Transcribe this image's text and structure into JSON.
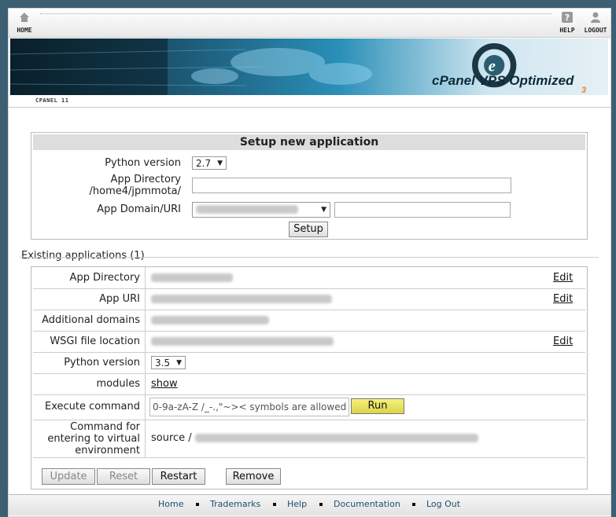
{
  "topbar": {
    "home_label": "HOME",
    "help_label": "HELP",
    "logout_label": "LOGOUT"
  },
  "banner": {
    "brand_text": "cPanel VPS Optimized",
    "brand_sub": "3"
  },
  "crumb": "CPANEL 11",
  "setup": {
    "title": "Setup new application",
    "python_version_label": "Python version",
    "python_version_value": "2.7",
    "app_dir_label_1": "App Directory",
    "app_dir_label_2": "/home4/jpmmota/",
    "app_dir_value": "",
    "app_domain_label": "App Domain/URI",
    "app_uri_value": "",
    "setup_button": "Setup"
  },
  "existing": {
    "title": "Existing applications (1)",
    "rows": {
      "app_directory": "App Directory",
      "app_uri": "App URI",
      "additional_domains": "Additional domains",
      "wsgi": "WSGI file location",
      "python_version": "Python version",
      "modules": "modules",
      "execute": "Execute command",
      "cmd_venv_1": "Command for",
      "cmd_venv_2": "entering to virtual",
      "cmd_venv_3": "environment"
    },
    "edit_label": "Edit",
    "python_version_value": "3.5",
    "modules_link": "show",
    "execute_placeholder": "0-9a-zA-Z /_-.,\"~>< symbols are allowed",
    "run_button": "Run",
    "source_prefix": "source /",
    "buttons": {
      "update": "Update",
      "reset": "Reset",
      "restart": "Restart",
      "remove": "Remove"
    }
  },
  "footer": {
    "home": "Home",
    "trademarks": "Trademarks",
    "help": "Help",
    "documentation": "Documentation",
    "logout": "Log Out"
  },
  "colors": {
    "highlight": "#f4f22b",
    "footer_link": "#1c4f6e",
    "brand_accent": "#d98f1a"
  }
}
